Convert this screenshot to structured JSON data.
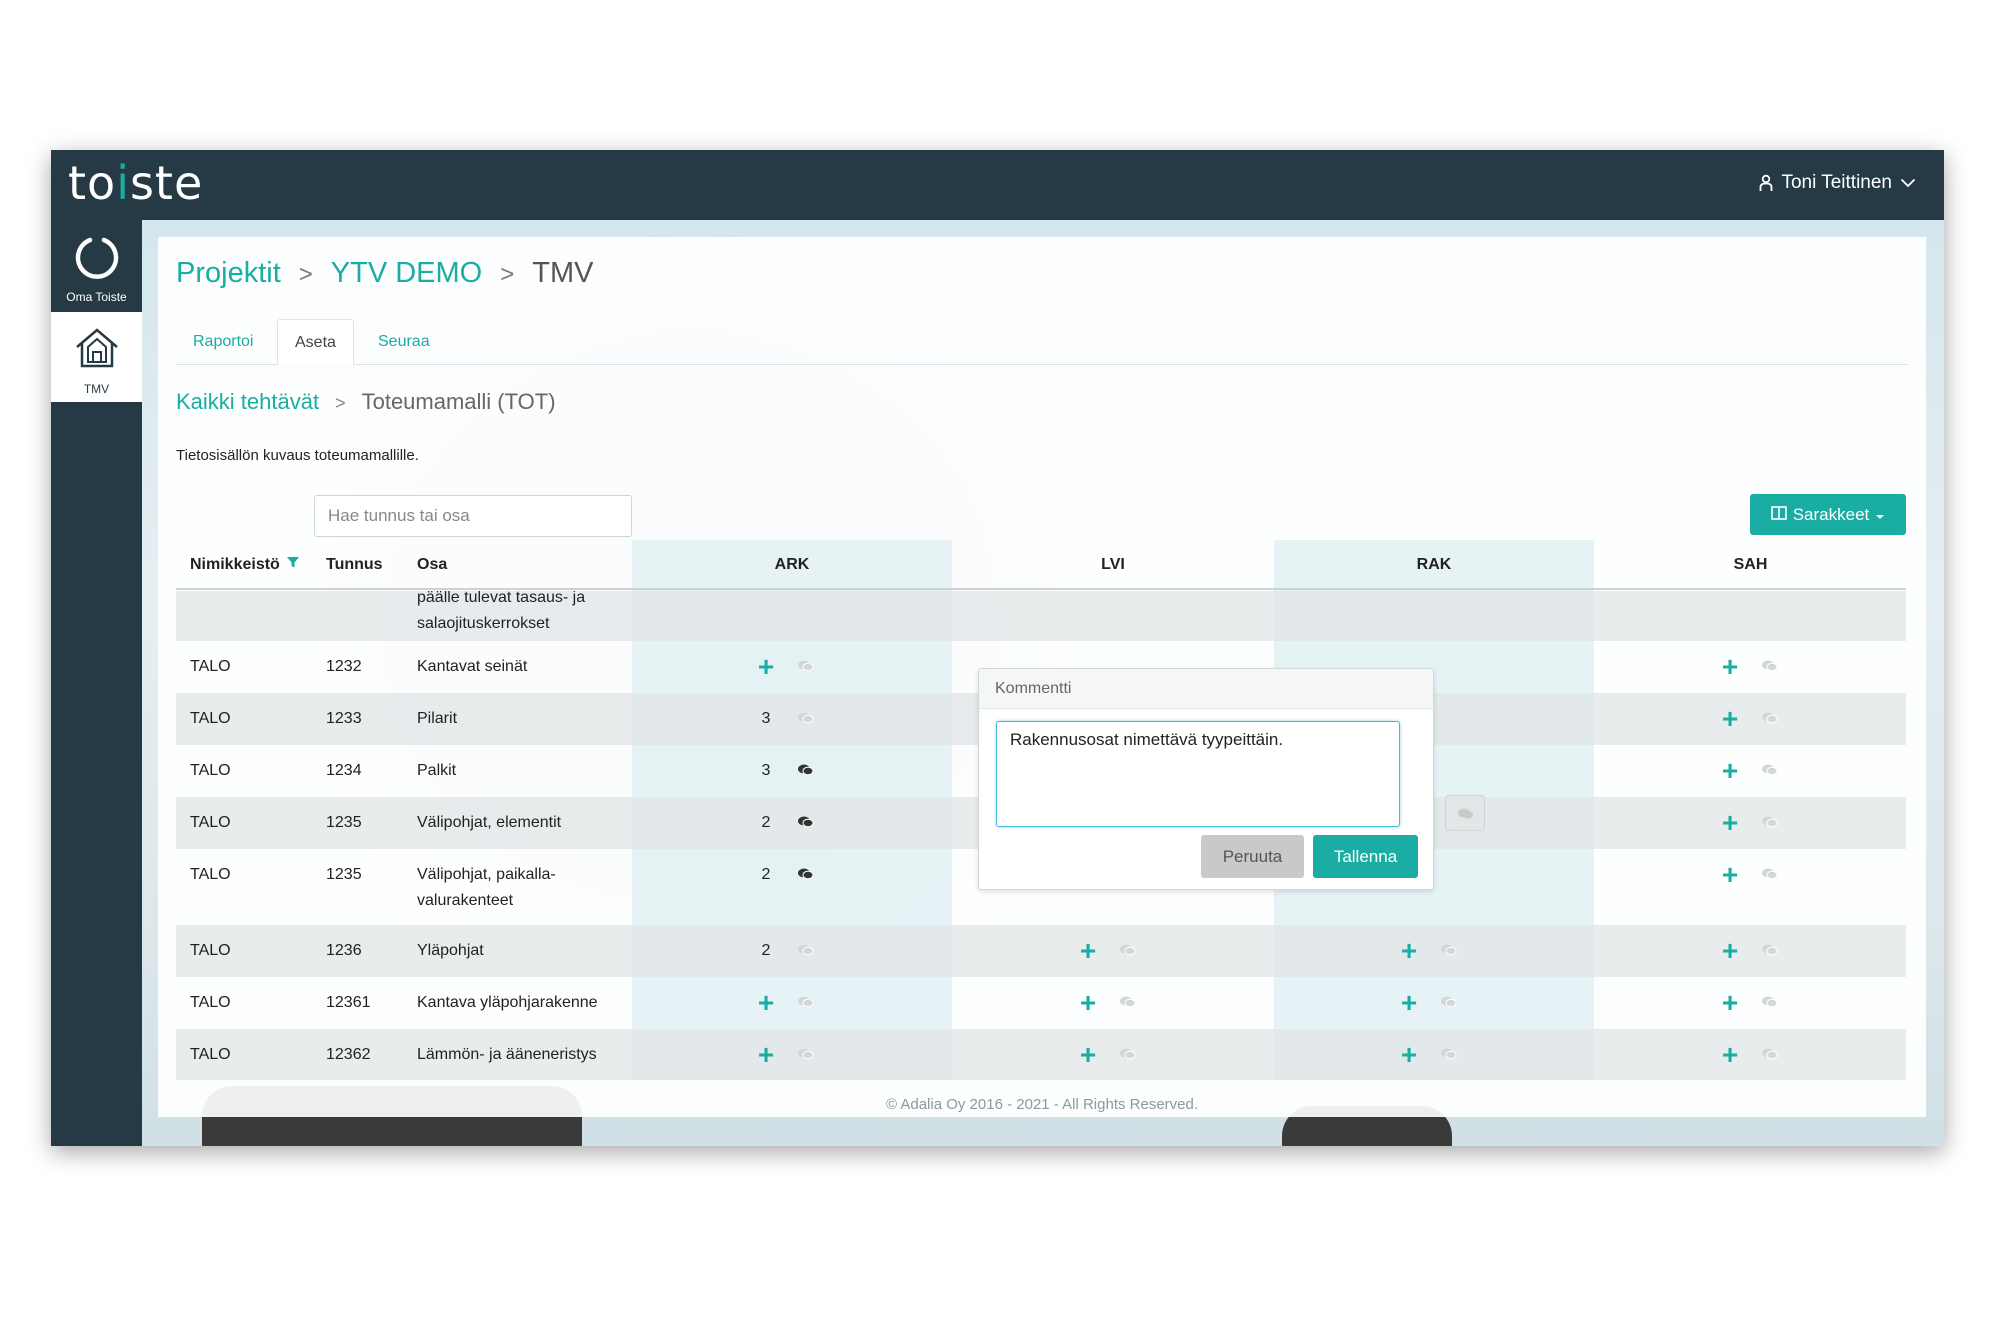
{
  "app": {
    "logo_text_a": "to",
    "logo_text_b": "i",
    "logo_text_c": "ste",
    "user_name": "Toni Teittinen",
    "accent_color": "#1aada3",
    "dark_color": "#253a44"
  },
  "sidebar": {
    "items": [
      {
        "label": "Oma Toiste",
        "icon": "ring-icon"
      },
      {
        "label": "TMV",
        "icon": "house-icon"
      }
    ]
  },
  "breadcrumb": [
    "Projektit",
    "YTV DEMO",
    "TMV"
  ],
  "breadcrumb_sep": ">",
  "tabs": [
    {
      "label": "Raportoi",
      "active": false
    },
    {
      "label": "Aseta",
      "active": true
    },
    {
      "label": "Seuraa",
      "active": false
    }
  ],
  "subcrumb": {
    "parent": "Kaikki tehtävät",
    "sep": ">",
    "current": "Toteumamalli (TOT)"
  },
  "description": "Tietosisällön kuvaus toteumamallille.",
  "search": {
    "placeholder": "Hae tunnus tai osa"
  },
  "columns_button": "Sarakkeet",
  "table": {
    "headers": {
      "nimikkeisto": "Nimikkeistö",
      "tunnus": "Tunnus",
      "osa": "Osa"
    },
    "disciplines": [
      "ARK",
      "LVI",
      "RAK",
      "SAH"
    ],
    "partial_row": {
      "osa_line1": "päälle tulevat tasaus- ja",
      "osa_line2": "salaojituskerrokset"
    },
    "rows": [
      {
        "nimikkeisto": "TALO",
        "tunnus": "1232",
        "osa": "Kantavat seinät",
        "osa2": "",
        "ARK": "+",
        "ARK_comment": false,
        "LVI": "",
        "RAK": "",
        "SAH": "+"
      },
      {
        "nimikkeisto": "TALO",
        "tunnus": "1233",
        "osa": "Pilarit",
        "osa2": "",
        "ARK": "3",
        "ARK_comment": false,
        "LVI": "",
        "RAK": "",
        "SAH": "+"
      },
      {
        "nimikkeisto": "TALO",
        "tunnus": "1234",
        "osa": "Palkit",
        "osa2": "",
        "ARK": "3",
        "ARK_comment": true,
        "LVI": "",
        "RAK": "",
        "SAH": "+"
      },
      {
        "nimikkeisto": "TALO",
        "tunnus": "1235",
        "osa": "Välipohjat, elementit",
        "osa2": "",
        "ARK": "2",
        "ARK_comment": true,
        "LVI": "",
        "RAK": "",
        "SAH": "+"
      },
      {
        "nimikkeisto": "TALO",
        "tunnus": "1235",
        "osa": "Välipohjat, paikalla-",
        "osa2": "valurakenteet",
        "ARK": "2",
        "ARK_comment": true,
        "LVI": "",
        "RAK": "",
        "SAH": "+"
      },
      {
        "nimikkeisto": "TALO",
        "tunnus": "1236",
        "osa": "Yläpohjat",
        "osa2": "",
        "ARK": "2",
        "ARK_comment": false,
        "LVI": "+",
        "RAK": "+",
        "SAH": "+"
      },
      {
        "nimikkeisto": "TALO",
        "tunnus": "12361",
        "osa": "Kantava yläpohjarakenne",
        "osa2": "",
        "ARK": "+",
        "ARK_comment": false,
        "LVI": "+",
        "RAK": "+",
        "SAH": "+"
      },
      {
        "nimikkeisto": "TALO",
        "tunnus": "12362",
        "osa": "Lämmön- ja ääneneristys",
        "osa2": "",
        "ARK": "+",
        "ARK_comment": false,
        "LVI": "+",
        "RAK": "+",
        "SAH": "+"
      }
    ]
  },
  "comment_popup": {
    "title": "Kommentti",
    "value": "Rakennusosat nimettävä tyypeittäin.",
    "cancel_label": "Peruuta",
    "save_label": "Tallenna"
  },
  "footer": "© Adalia Oy 2016 - 2021 - All Rights Reserved."
}
